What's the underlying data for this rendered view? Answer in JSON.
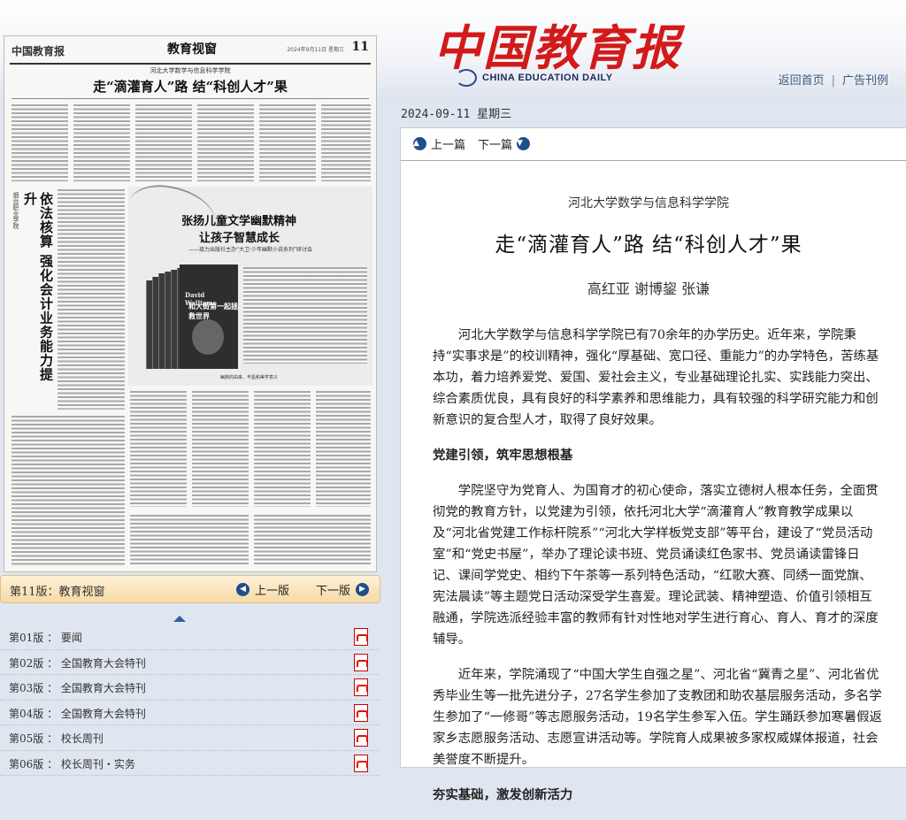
{
  "header": {
    "logo_cn": "中国教育报",
    "logo_en": "CHINA EDUCATION DAILY",
    "links": [
      "返回首页",
      "广告刊例"
    ]
  },
  "paper": {
    "masthead": "中国教育报",
    "section": "教育视窗",
    "date_line": "2024年9月11日 星期三",
    "page_number": "11",
    "kicker": "河北大学数学与信息科学学院",
    "title": "走“滴灌育人”路 结“科创人才”果",
    "left_vertical_tag": "烟台职业学院",
    "left_vertical_title": "依法核算 强化会计业务能力提升",
    "promo_title_1": "张扬儿童文学幽默精神",
    "promo_title_2": "让孩子智慧成长",
    "promo_subtitle": "——接力出版社主办“大卫·少年幽默小说系列”研讨会",
    "book_en": "David Walliams",
    "book_cn": "和大街第一起拯救世界",
    "promo_caption": "幽默的由来、丰盈和美学意义"
  },
  "paper_footer": {
    "label": "第11版：教育视窗",
    "prev": "上一版",
    "next": "下一版"
  },
  "editions": [
    {
      "label": "第01版 ： 要闻"
    },
    {
      "label": "第02版 ： 全国教育大会特刊"
    },
    {
      "label": "第03版 ： 全国教育大会特刊"
    },
    {
      "label": "第04版 ： 全国教育大会特刊"
    },
    {
      "label": "第05版 ： 校长周刊"
    },
    {
      "label": "第06版 ： 校长周刊・实务"
    }
  ],
  "article": {
    "date": "2024-09-11 星期三",
    "prev": "上一篇",
    "next": "下一篇",
    "kicker": "河北大学数学与信息科学学院",
    "title": "走“滴灌育人”路 结“科创人才”果",
    "authors": "高红亚 谢博鋆 张谦",
    "p1": "河北大学数学与信息科学学院已有70余年的办学历史。近年来，学院秉持“实事求是”的校训精神，强化“厚基础、宽口径、重能力”的办学特色，苦练基本功，着力培养爱党、爱国、爱社会主义，专业基础理论扎实、实践能力突出、综合素质优良，具有良好的科学素养和思维能力，具有较强的科学研究能力和创新意识的复合型人才，取得了良好效果。",
    "h1": "党建引领，筑牢思想根基",
    "p2": "学院坚守为党育人、为国育才的初心使命，落实立德树人根本任务，全面贯彻党的教育方针，以党建为引领，依托河北大学“滴灌育人”教育教学成果以及“河北省党建工作标杆院系”“河北大学样板党支部”等平台，建设了“党员活动室”和“党史书屋”，举办了理论读书班、党员诵读红色家书、党员诵读雷锋日记、课间学党史、相约下午茶等一系列特色活动，“红歌大赛、同绣一面党旗、宪法晨读”等主题党日活动深受学生喜爱。理论武装、精神塑造、价值引领相互融通，学院选派经验丰富的教师有针对性地对学生进行育心、育人、育才的深度辅导。",
    "p3": "近年来，学院涌现了“中国大学生自强之星”、河北省“冀青之星”、河北省优秀毕业生等一批先进分子，27名学生参加了支教团和助农基层服务活动，多名学生参加了“一修哥”等志愿服务活动，19名学生参军入伍。学生踊跃参加寒暑假返家乡志愿服务活动、志愿宣讲活动等。学院育人成果被多家权威媒体报道，社会美誉度不断提升。",
    "h2": "夯实基础，激发创新活力"
  },
  "colors": {
    "logo_red": "#d21a1a",
    "nav_blue": "#1f4e8c",
    "footer_orange": "#f6d9a6"
  }
}
